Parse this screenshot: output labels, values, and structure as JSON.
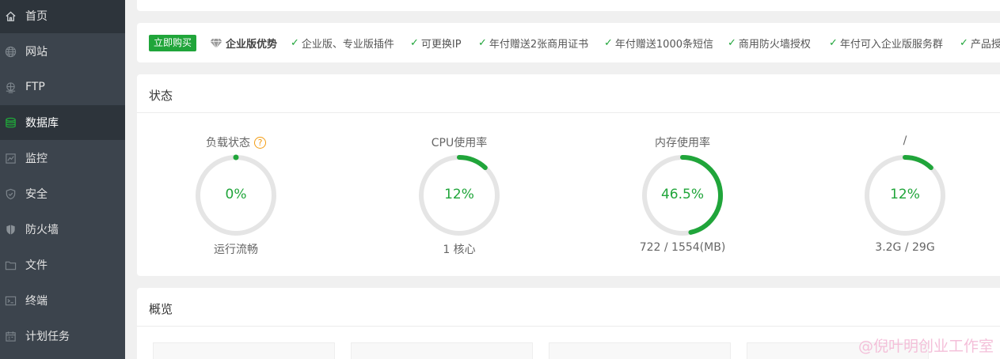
{
  "sidebar": {
    "items": [
      {
        "label": "首页",
        "icon": "home-icon"
      },
      {
        "label": "网站",
        "icon": "globe-icon"
      },
      {
        "label": "FTP",
        "icon": "ftp-icon"
      },
      {
        "label": "数据库",
        "icon": "database-icon"
      },
      {
        "label": "监控",
        "icon": "monitor-icon"
      },
      {
        "label": "安全",
        "icon": "shield-check-icon"
      },
      {
        "label": "防火墙",
        "icon": "firewall-shield-icon"
      },
      {
        "label": "文件",
        "icon": "folder-icon"
      },
      {
        "label": "终端",
        "icon": "terminal-icon"
      },
      {
        "label": "计划任务",
        "icon": "calendar-icon"
      }
    ]
  },
  "promo": {
    "buy_label": "立即购买",
    "title": "企业版优势",
    "features": [
      "企业版、专业版插件",
      "可更换IP",
      "年付赠送2张商用证书",
      "年付赠送1000条短信",
      "商用防火墙授权",
      "年付可入企业版服务群",
      "产品授"
    ]
  },
  "status": {
    "title": "状态",
    "help_icon": "?",
    "gauges": [
      {
        "title": "负载状态",
        "value_text": "0%",
        "percent": 0,
        "sub": "运行流畅",
        "has_help": true
      },
      {
        "title": "CPU使用率",
        "value_text": "12%",
        "percent": 12,
        "sub": "1 核心",
        "has_help": false
      },
      {
        "title": "内存使用率",
        "value_text": "46.5%",
        "percent": 46.5,
        "sub": "722 / 1554(MB)",
        "has_help": false
      },
      {
        "title": "/",
        "value_text": "12%",
        "percent": 12,
        "sub": "3.2G / 29G",
        "has_help": false
      }
    ]
  },
  "overview": {
    "title": "概览"
  },
  "watermark": "@倪叶明创业工作室",
  "colors": {
    "accent": "#20a53a",
    "sidebar_bg": "#3c444d",
    "sidebar_active": "#2d343b",
    "gauge_track": "#e5e5e5",
    "help": "#f39c12"
  }
}
